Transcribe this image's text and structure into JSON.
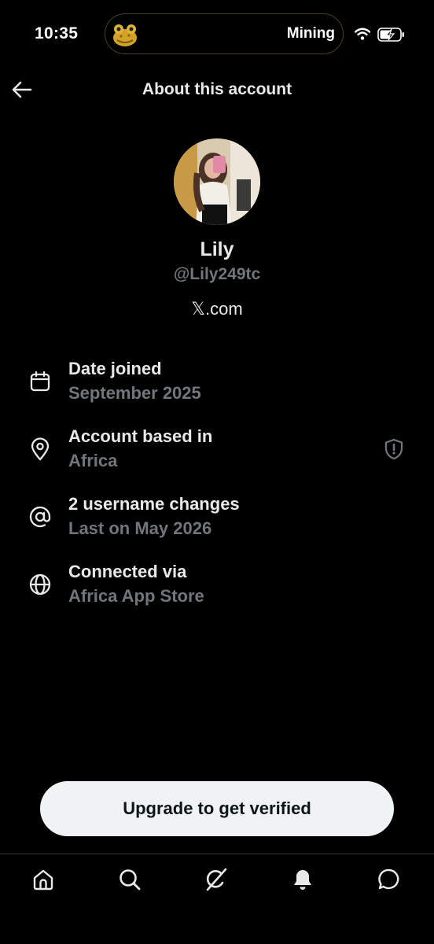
{
  "status_bar": {
    "time": "10:35",
    "activity_label": "Mining",
    "activity_icon": "frog-icon"
  },
  "header": {
    "title": "About this account",
    "back_icon": "arrow-left-icon"
  },
  "profile": {
    "name": "Lily",
    "handle": "@Lily249tc",
    "site_x": "𝕏",
    "site_rest": ".com"
  },
  "details": [
    {
      "icon": "calendar-icon",
      "title": "Date joined",
      "value": "September 2025"
    },
    {
      "icon": "location-pin-icon",
      "title": "Account based in",
      "value": "Africa",
      "trailing_icon": "shield-alert-icon"
    },
    {
      "icon": "at-sign-icon",
      "title": "2 username changes",
      "value": "Last on May 2026"
    },
    {
      "icon": "globe-icon",
      "title": "Connected via",
      "value": "Africa App Store"
    }
  ],
  "upgrade_button": {
    "label": "Upgrade to get verified"
  },
  "bottom_nav": {
    "items": [
      "home-icon",
      "search-icon",
      "grok-icon",
      "notifications-icon",
      "messages-icon"
    ]
  },
  "colors": {
    "background": "#000000",
    "primary_text": "#e7e9ea",
    "secondary_text": "#71767b",
    "button_bg": "#eff3f4"
  }
}
